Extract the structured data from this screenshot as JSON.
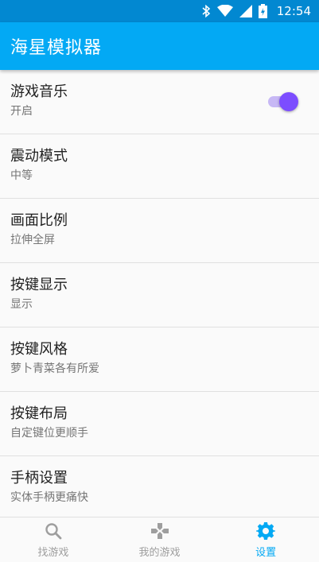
{
  "status_bar": {
    "time": "12:54",
    "icons": [
      "bluetooth-icon",
      "wifi-icon",
      "signal-icon",
      "battery-charging-icon"
    ]
  },
  "app_bar": {
    "title": "海星模拟器"
  },
  "settings": {
    "items": [
      {
        "title": "游戏音乐",
        "summary": "开启",
        "toggle_on": true
      },
      {
        "title": "震动模式",
        "summary": "中等"
      },
      {
        "title": "画面比例",
        "summary": "拉伸全屏"
      },
      {
        "title": "按键显示",
        "summary": "显示"
      },
      {
        "title": "按键风格",
        "summary": "萝卜青菜各有所爱"
      },
      {
        "title": "按键布局",
        "summary": "自定键位更顺手"
      },
      {
        "title": "手柄设置",
        "summary": "实体手柄更痛快"
      }
    ]
  },
  "bottom_nav": {
    "items": [
      {
        "label": "找游戏",
        "icon": "search-icon"
      },
      {
        "label": "我的游戏",
        "icon": "gamepad-icon"
      },
      {
        "label": "设置",
        "icon": "gear-icon",
        "active": true
      }
    ]
  },
  "colors": {
    "status_bar": "#0288d1",
    "app_bar": "#03a9f4",
    "toggle_thumb": "#7c4dff",
    "toggle_track": "#c7b8f5",
    "nav_active": "#03a9f4",
    "nav_inactive": "#9e9e9e"
  }
}
